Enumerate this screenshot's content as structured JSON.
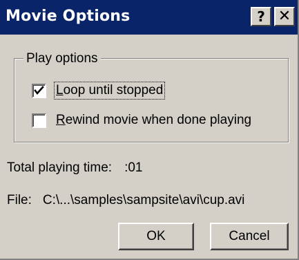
{
  "window": {
    "title": "Movie Options",
    "help_glyph": "?",
    "close_glyph": "✕"
  },
  "play_options": {
    "legend": "Play options",
    "loop": {
      "label_mnemonic": "L",
      "label_rest": "oop until stopped",
      "checked": true
    },
    "rewind": {
      "label_mnemonic": "R",
      "label_rest": "ewind movie when done playing",
      "checked": false
    }
  },
  "info": {
    "time_label": "Total playing time:",
    "time_value": ":01",
    "file_label": "File:",
    "file_value": "C:\\...\\samples\\sampsite\\avi\\cup.avi"
  },
  "buttons": {
    "ok": "OK",
    "cancel": "Cancel"
  }
}
